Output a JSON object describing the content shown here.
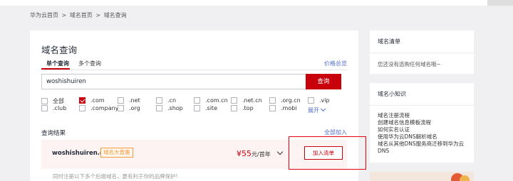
{
  "breadcrumb": {
    "items": [
      "华为云首页",
      ">",
      "域名首页",
      ">",
      "域名查询"
    ]
  },
  "main": {
    "title": "域名查询",
    "tabs": [
      {
        "label": "单个查询",
        "active": true
      },
      {
        "label": "多个查询",
        "active": false
      }
    ],
    "price_link": "价格总览",
    "search": {
      "value": "woshishuiren",
      "button_label": "查询"
    },
    "suffixes": [
      {
        "label": "全部",
        "checked": false
      },
      {
        "label": ".com",
        "checked": true
      },
      {
        "label": ".net",
        "checked": false
      },
      {
        "label": ".cn",
        "checked": false
      },
      {
        "label": ".com.cn",
        "checked": false
      },
      {
        "label": ".net.cn",
        "checked": false
      },
      {
        "label": ".org.cn",
        "checked": false
      },
      {
        "label": ".vip",
        "checked": false
      },
      {
        "label": ".club",
        "checked": false
      },
      {
        "label": ".company",
        "checked": false
      },
      {
        "label": ".org",
        "checked": false
      },
      {
        "label": ".shop",
        "checked": false
      },
      {
        "label": ".site",
        "checked": false
      },
      {
        "label": ".top",
        "checked": false
      },
      {
        "label": ".mobi",
        "checked": false
      }
    ],
    "expand_label": "展开",
    "results_title": "查询结果",
    "add_all_label": "全部加入",
    "result": {
      "domain": "woshishuiren.com",
      "badge": "域名大普惠",
      "price_symbol": "¥",
      "price_value": "55",
      "price_unit": "元/首年",
      "add_button": "加入清单"
    },
    "footer_note": "同时注册以下多个后缀域名，更有利于你的品牌保护!"
  },
  "sidebar": {
    "list_card": {
      "title": "域名清单",
      "empty_text": "您还没有选购任何域名哦~"
    },
    "tips_card": {
      "title": "域名小知识",
      "links": [
        "域名注册流程",
        "创建域名信息模板流程",
        "如何实名认证",
        "使用华为云DNS解析域名",
        "域名从其他DNS服务商迁移到华为云DNS"
      ]
    }
  },
  "colors": {
    "brand_red": "#c7000b",
    "link_blue": "#526ecc",
    "badge_orange": "#f39a3d",
    "annotation_red": "#e60012"
  }
}
